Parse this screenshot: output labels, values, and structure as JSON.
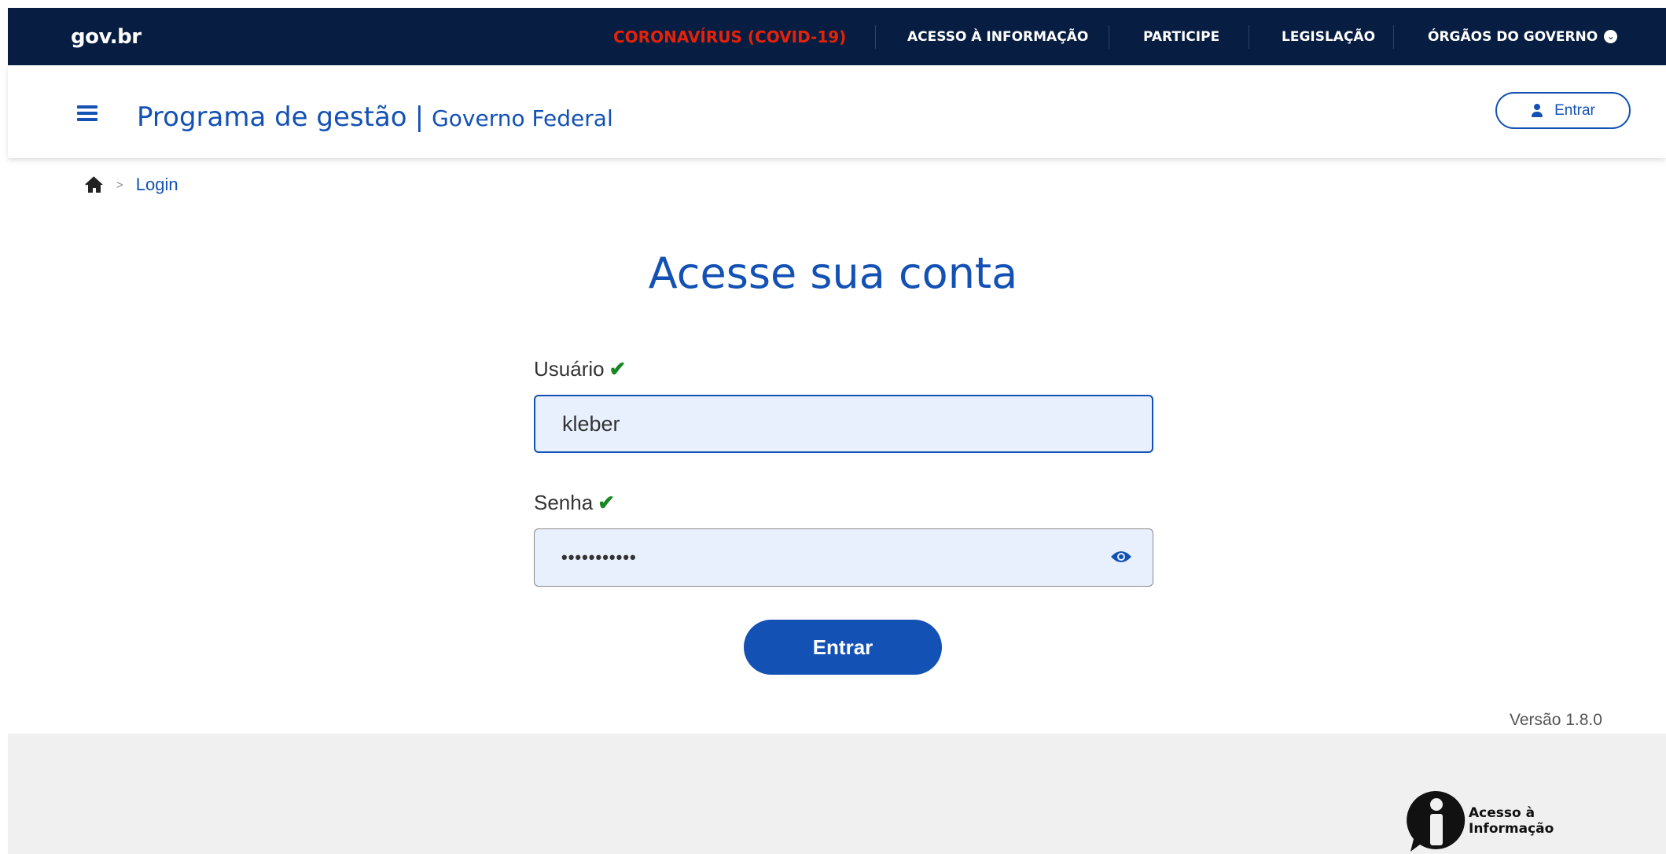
{
  "govbar": {
    "logo": "gov.br",
    "links": [
      {
        "label": "CORONAVÍRUS (COVID-19)"
      },
      {
        "label": "ACESSO À INFORMAÇÃO"
      },
      {
        "label": "PARTICIPE"
      },
      {
        "label": "LEGISLAÇÃO"
      },
      {
        "label": "ÓRGÃOS DO GOVERNO"
      }
    ],
    "colors": {
      "background": "#071d41",
      "covid": "#e52207"
    }
  },
  "header": {
    "title": "Programa de gestão",
    "divider": "|",
    "subtitle": "Governo Federal",
    "login_button": "Entrar",
    "menu_icon": "hamburger-icon",
    "user_icon": "user-icon"
  },
  "breadcrumb": {
    "home_icon": "home-icon",
    "separator": ">",
    "current": "Login"
  },
  "login": {
    "title": "Acesse sua conta",
    "username_label": "Usuário",
    "username_value": "kleber",
    "password_label": "Senha",
    "password_value": "•••••••••••",
    "submit_label": "Entrar",
    "valid_icon": "check-icon",
    "toggle_password_icon": "eye-icon"
  },
  "version": "Versão 1.8.0",
  "footer": {
    "logo_line1": "Acesso à",
    "logo_line2": "Informação"
  },
  "theme": {
    "primary": "#1351b4",
    "success": "#168821",
    "footer_bg": "#f0f0f0",
    "input_bg": "#e8f0fe"
  }
}
